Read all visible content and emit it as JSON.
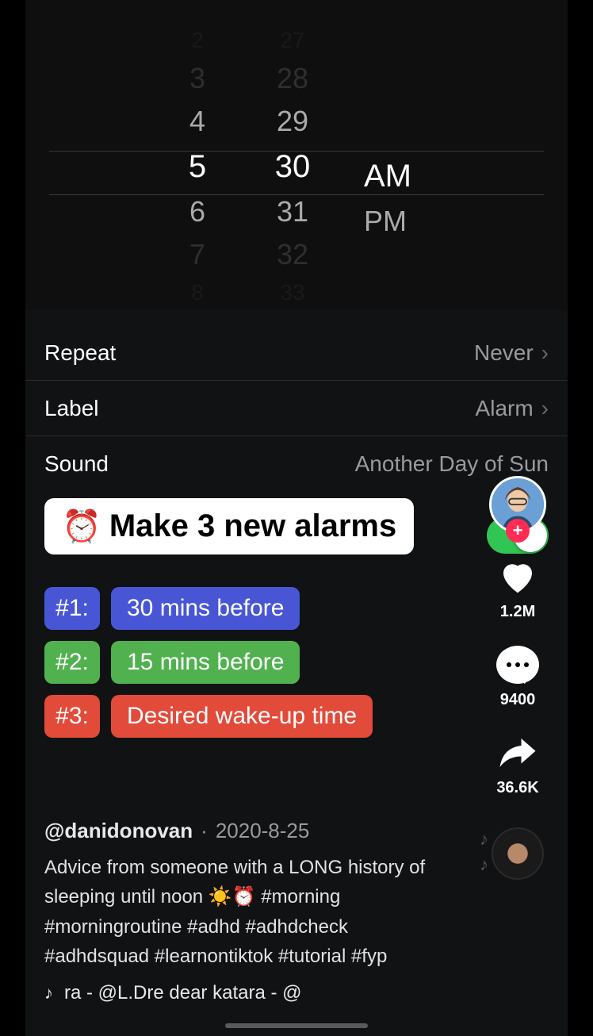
{
  "picker": {
    "hour": {
      "edge_top": "2",
      "far_top": "3",
      "near_top": "4",
      "selected": "5",
      "near_bot": "6",
      "far_bot": "7",
      "edge_bot": "8"
    },
    "minute": {
      "edge_top": "27",
      "far_top": "28",
      "near_top": "29",
      "selected": "30",
      "near_bot": "31",
      "far_bot": "32",
      "edge_bot": "33"
    },
    "ampm": {
      "selected": "AM",
      "other": "PM"
    }
  },
  "settings": {
    "repeat": {
      "label": "Repeat",
      "value": "Never"
    },
    "label": {
      "label": "Label",
      "value": "Alarm"
    },
    "sound": {
      "label": "Sound",
      "value": "Another Day of Sun"
    }
  },
  "caption": {
    "emoji": "⏰",
    "text": "Make 3 new alarms"
  },
  "tags": [
    {
      "num": "#1:",
      "text": "30 mins before",
      "color": "blue"
    },
    {
      "num": "#2:",
      "text": "15 mins before",
      "color": "green"
    },
    {
      "num": "#3:",
      "text": "Desired wake-up time",
      "color": "red"
    }
  ],
  "meta": {
    "author": "@danidonovan",
    "dot": "·",
    "date": "2020-8-25",
    "desc": "Advice from someone with a LONG history of sleeping until noon ☀️⏰ #morning #morningroutine #adhd #adhdcheck #adhdsquad #learnontiktok #tutorial #fyp",
    "music": "ra - @L.Dre    dear katara - @"
  },
  "rail": {
    "likes": "1.2M",
    "comments": "9400",
    "shares": "36.6K"
  }
}
